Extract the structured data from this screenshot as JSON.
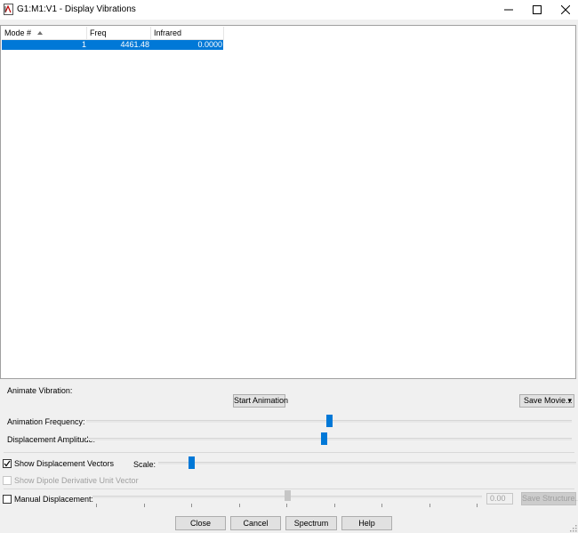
{
  "window": {
    "title": "G1:M1:V1 - Display Vibrations",
    "icons": [
      "app-icon",
      "minimize-icon",
      "maximize-icon",
      "close-icon"
    ]
  },
  "table": {
    "columns": [
      "Mode #",
      "Freq",
      "Infrared"
    ],
    "sort_icon": "sort-ascending-icon",
    "rows": [
      {
        "mode": "1",
        "freq": "4461.48",
        "infrared": "0.0000"
      }
    ]
  },
  "animate": {
    "label": "Animate Vibration:",
    "start_button": "Start Animation",
    "save_movie_button": "Save Movie...",
    "save_movie_arrow": "▾",
    "frequency_label": "Animation Frequency:",
    "frequency_level": 0.5,
    "amplitude_label": "Displacement Amplitude:",
    "amplitude_level": 0.49
  },
  "vectors": {
    "show_displacement_label": "Show Displacement Vectors",
    "show_displacement_checked": true,
    "scale_label": "Scale:",
    "scale_level": 0.08,
    "show_dipole_label": "Show Dipole Derivative Unit Vector",
    "show_dipole_checked": false
  },
  "manual": {
    "label": "Manual Displacement:",
    "checked": false,
    "value": "0.00",
    "level": 0.5,
    "save_structure_button": "Save Structure..."
  },
  "footer": {
    "close": "Close",
    "cancel": "Cancel",
    "spectrum": "Spectrum",
    "help": "Help"
  },
  "colors": {
    "selection": "#0078d7",
    "slider_thumb": "#0078d7",
    "background": "#f0f0f0"
  }
}
